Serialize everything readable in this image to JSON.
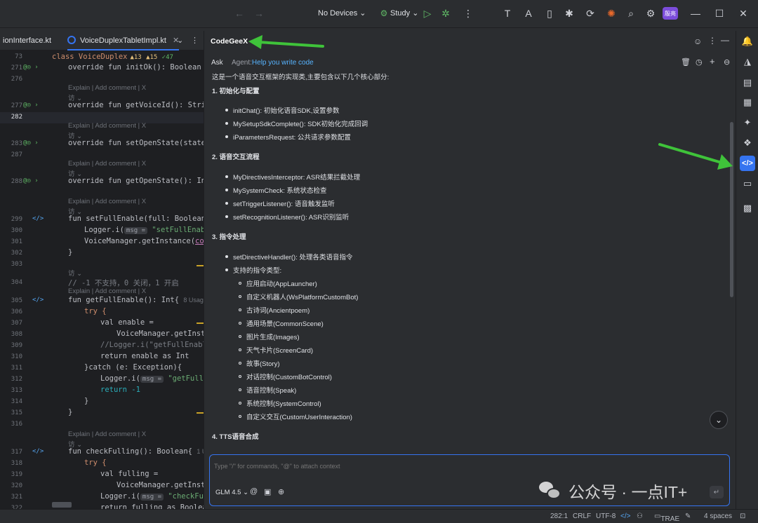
{
  "toolbar": {
    "devices": "No Devices",
    "run_config": "Study",
    "avatar_text": "殷亮"
  },
  "editor_tabs": [
    {
      "label": "ionInterface.kt"
    },
    {
      "label": "VoiceDuplexTabletImpl.kt"
    }
  ],
  "editor": {
    "class_header": {
      "line": "73",
      "code": "class VoiceDuplex",
      "warn": "▲13",
      "warn2": "▲15",
      "ok": "✓47"
    },
    "lines": {
      "l271": "271",
      "l276": "276",
      "l277": "277",
      "l282": "282",
      "l283": "283",
      "l287": "287",
      "l288": "288",
      "l299": "299",
      "l300": "300",
      "l301": "301",
      "l302": "302",
      "l303": "303",
      "l304": "304",
      "l305": "305",
      "l306": "306",
      "l307": "307",
      "l308": "308",
      "l309": "309",
      "l310": "310",
      "l311": "311",
      "l312": "312",
      "l313": "313",
      "l314": "314",
      "l315": "315",
      "l316": "316",
      "l317": "317",
      "l318": "318",
      "l319": "319",
      "l320": "320",
      "l321": "321",
      "l322": "322"
    },
    "hint_explain": "Explain | Add comment | X",
    "hint_author": "访 ⌄",
    "hint_usages8": "8 Usages",
    "hint_usages1": "1 Us",
    "comment_304": "// -1 不支持，0 关闭，1 开启",
    "msg_param": "msg =",
    "code": {
      "initok": "override fun initOk(): Boolean",
      "getvoice": "override fun getVoiceId(): String",
      "setopen": "override fun setOpenState(state:",
      "getopen": "override fun getOpenState(): Int",
      "setfull": "fun setFullEnable(full: Boolean){",
      "logger1": "Logger.i(",
      "logger1_str": "\"setFullEnable",
      "vm1": "VoiceManager.getInstance(",
      "vm1_b": "cont",
      "close": "}",
      "getfull": "fun getFullEnable(): Int{",
      "try": "try {",
      "val_enable": "val enable =",
      "vm2": "VoiceManager.getInsta",
      "cm_logger": "//Logger.i(\"getFullEnable",
      "ret_enable": "return enable as Int",
      "catch": "}catch (e: Exception){",
      "logger2": "Logger.i(",
      "logger2_str": "\"getFullEn",
      "ret_neg": "return -1",
      "checkful": "fun checkFulling(): Boolean{",
      "val_fulling": "val fulling =",
      "vm3": "VoiceManager.getInsta",
      "logger3": "Logger.i(",
      "logger3_str": "\"checkFul",
      "ret_fulling": "return fulling as Boolean"
    }
  },
  "panel": {
    "title": "CodeGeeX",
    "mode_ask": "Ask",
    "mode_agent": "Agent:",
    "agent_desc": "Help you write code",
    "intro": "这是一个语音交互框架的实现类,主要包含以下几个核心部分:",
    "sections": [
      {
        "title": "1. 初始化与配置",
        "items": [
          "initChat(): 初始化语音SDK,设置参数",
          "MySetupSdkComplete(): SDK初始化完成回调",
          "iParametersRequest: 公共请求参数配置"
        ]
      },
      {
        "title": "2. 语音交互流程",
        "items": [
          "MyDirectivesInterceptor: ASR结果拦截处理",
          "MySystemCheck: 系统状态检查",
          "setTriggerListener(): 语音触发监听",
          "setRecognitionListener(): ASR识别监听"
        ]
      },
      {
        "title": "3. 指令处理",
        "items": [
          "setDirectiveHandler(): 处理各类语音指令",
          "支持的指令类型:"
        ]
      },
      {
        "title": "4. TTS语音合成"
      }
    ],
    "subitems": [
      "应用启动(AppLauncher)",
      "自定义机器人(WsPlatformCustomBot)",
      "古诗词(Ancientpoem)",
      "通用场景(CommonScene)",
      "图片生成(Images)",
      "天气卡片(ScreenCard)",
      "故事(Story)",
      "对话控制(CustomBotControl)",
      "语音控制(Speak)",
      "系统控制(SystemControl)",
      "自定义交互(CustomUserInteraction)"
    ],
    "input_placeholder": "Type \"/\" for commands, \"@\" to attach context",
    "model": "GLM 4.5 ⌄"
  },
  "watermark": "公众号 · 一点IT+",
  "status": {
    "position": "282:1",
    "line_sep": "CRLF",
    "encoding": "UTF-8",
    "trae": "TRAE",
    "indent": "4 spaces"
  },
  "colors": {
    "accent": "#3574f0",
    "arrow": "#3fc33a"
  }
}
